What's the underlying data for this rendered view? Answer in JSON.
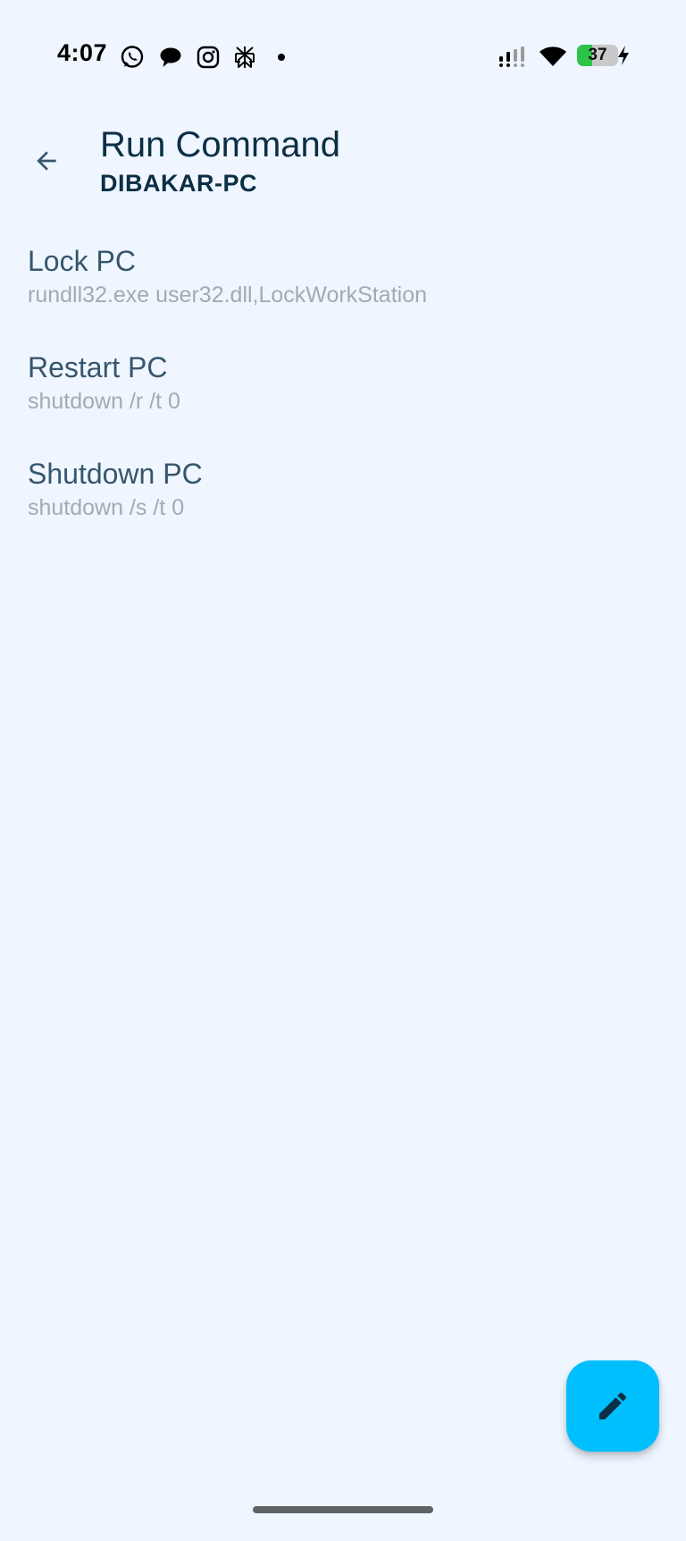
{
  "status_bar": {
    "time": "4:07",
    "notification_icons": [
      "whatsapp-icon",
      "chat-bubble-icon",
      "instagram-icon",
      "perplexity-icon"
    ],
    "battery_level": "37",
    "battery_fraction": 0.37,
    "charging": true,
    "colors": {
      "battery_fill": "#2dc44a",
      "battery_track": "#c9c9c9"
    }
  },
  "app_bar": {
    "back_icon": "arrow-back-icon",
    "title": "Run Command",
    "subtitle": "DIBAKAR-PC"
  },
  "commands": [
    {
      "name": "Lock PC",
      "command": "rundll32.exe user32.dll,LockWorkStation"
    },
    {
      "name": "Restart PC",
      "command": "shutdown /r /t 0"
    },
    {
      "name": "Shutdown PC",
      "command": "shutdown /s /t 0"
    }
  ],
  "fab": {
    "icon": "edit-pencil-icon",
    "color": "#00bfff"
  },
  "theme": {
    "background": "#eff6ff",
    "title_color": "#0b2f45",
    "item_title_color": "#37566d",
    "item_subtitle_color": "#a5aab0"
  }
}
